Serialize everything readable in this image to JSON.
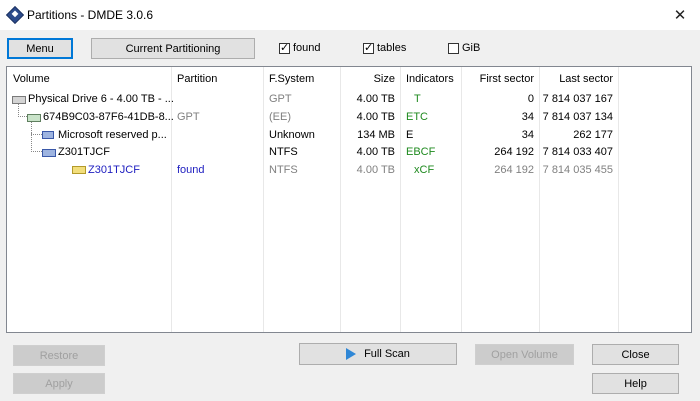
{
  "window": {
    "title": "Partitions - DMDE 3.0.6",
    "close_glyph": "✕"
  },
  "toolbar": {
    "menu_label": "Menu",
    "current_partitioning_label": "Current Partitioning",
    "found_label": "found",
    "found_checked": true,
    "tables_label": "tables",
    "tables_checked": true,
    "gib_label": "GiB",
    "gib_checked": false
  },
  "table": {
    "headers": {
      "volume": "Volume",
      "partition": "Partition",
      "fsystem": "F.System",
      "size": "Size",
      "indicators": "Indicators",
      "first_sector": "First sector",
      "last_sector": "Last sector"
    },
    "rows": [
      {
        "volume": "Physical Drive 6 - 4.00 TB - ...",
        "partition": "",
        "fsystem": "GPT",
        "size": "4.00 TB",
        "indicators": "T",
        "first_sector": "0",
        "last_sector": "7 814 037 167",
        "icon": "drive-icon"
      },
      {
        "volume": "674B9C03-87F6-41DB-8...",
        "partition": "GPT",
        "fsystem": "(EE)",
        "size": "4.00 TB",
        "indicators": "ETC",
        "first_sector": "34",
        "last_sector": "7 814 037 134",
        "icon": "partition-icon"
      },
      {
        "volume": "Microsoft reserved p...",
        "partition": "",
        "fsystem": "Unknown",
        "size": "134 MB",
        "indicators": "E",
        "first_sector": "34",
        "last_sector": "262 177",
        "icon": "unknown-partition-icon"
      },
      {
        "volume": "Z301TJCF",
        "partition": "",
        "fsystem": "NTFS",
        "size": "4.00 TB",
        "indicators": "EBCF",
        "first_sector": "264 192",
        "last_sector": "7 814 033 407",
        "icon": "ntfs-partition-icon"
      },
      {
        "volume": "Z301TJCF",
        "partition": "found",
        "fsystem": "NTFS",
        "size": "4.00 TB",
        "indicators": "xCF",
        "first_sector": "264 192",
        "last_sector": "7 814 035 455",
        "icon": "found-volume-icon"
      }
    ]
  },
  "buttons": {
    "restore": "Restore",
    "apply": "Apply",
    "full_scan": "Full Scan",
    "open_volume": "Open Volume",
    "close": "Close",
    "help": "Help"
  },
  "colors": {
    "accent": "#0078d7",
    "indicator_green": "#1f8a1f",
    "found_blue": "#2020c0"
  }
}
